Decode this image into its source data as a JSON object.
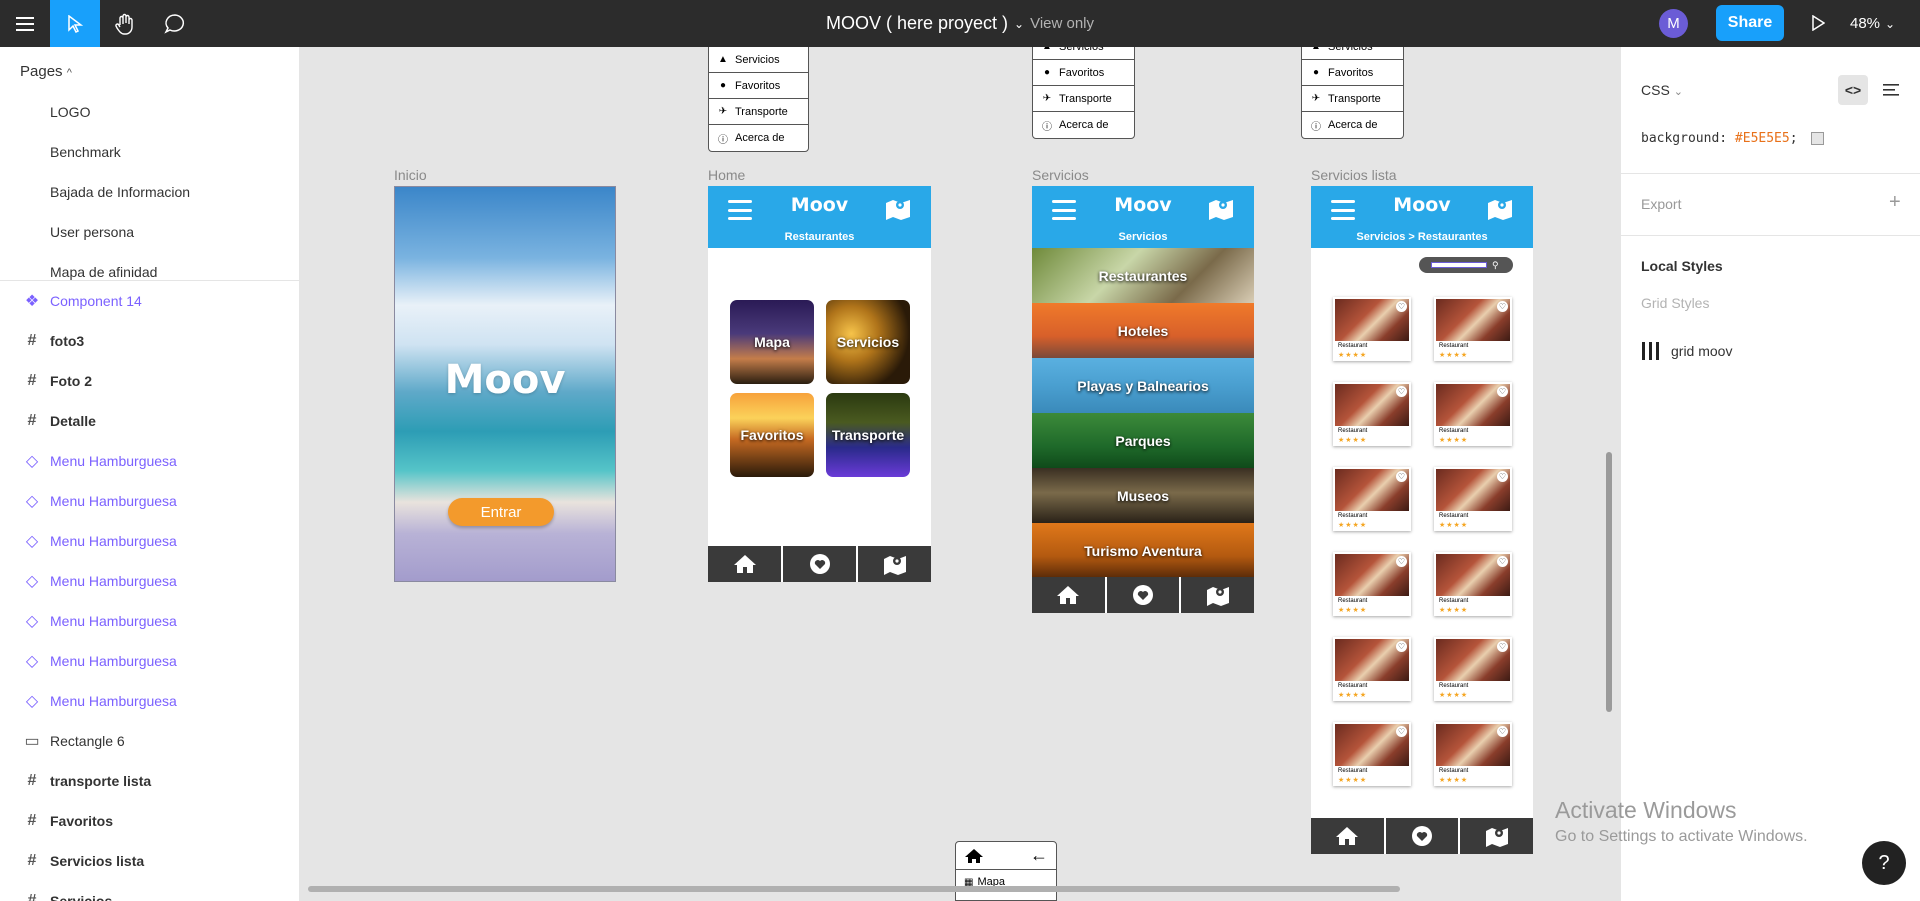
{
  "topbar": {
    "title": "MOOV ( here proyect )",
    "view_only": "View only",
    "avatar_initial": "M",
    "share_label": "Share",
    "zoom": "48%"
  },
  "pages": {
    "header": "Pages",
    "items": [
      "LOGO",
      "Benchmark",
      "Bajada de Informacion",
      "User persona",
      "Mapa de afinidad"
    ]
  },
  "layers": [
    {
      "label": "Component 14",
      "kind": "component"
    },
    {
      "label": "foto3",
      "kind": "frame"
    },
    {
      "label": "Foto 2",
      "kind": "frame"
    },
    {
      "label": "Detalle",
      "kind": "frame"
    },
    {
      "label": "Menu Hamburguesa",
      "kind": "instance"
    },
    {
      "label": "Menu Hamburguesa",
      "kind": "instance"
    },
    {
      "label": "Menu Hamburguesa",
      "kind": "instance"
    },
    {
      "label": "Menu Hamburguesa",
      "kind": "instance"
    },
    {
      "label": "Menu Hamburguesa",
      "kind": "instance"
    },
    {
      "label": "Menu Hamburguesa",
      "kind": "instance"
    },
    {
      "label": "Menu Hamburguesa",
      "kind": "instance"
    },
    {
      "label": "Rectangle 6",
      "kind": "rectangle"
    },
    {
      "label": "transporte lista",
      "kind": "frame"
    },
    {
      "label": "Favoritos",
      "kind": "frame"
    },
    {
      "label": "Servicios lista",
      "kind": "frame"
    },
    {
      "label": "Servicios",
      "kind": "frame"
    }
  ],
  "canvas": {
    "menu_items": [
      "Servicios",
      "Favoritos",
      "Transporte",
      "Acerca de"
    ],
    "bottom_menu": {
      "item": "Mapa"
    },
    "frames": {
      "inicio": {
        "label": "Inicio",
        "logo": "Moov",
        "button": "Entrar"
      },
      "home": {
        "label": "Home",
        "logo": "Moov",
        "subtitle": "Restaurantes",
        "tiles": [
          "Mapa",
          "Servicios",
          "Favoritos",
          "Transporte"
        ]
      },
      "servicios": {
        "label": "Servicios",
        "logo": "Moov",
        "subtitle": "Servicios",
        "bands": [
          "Restaurantes",
          "Hoteles",
          "Playas y Balnearios",
          "Parques",
          "Museos",
          "Turismo Aventura"
        ]
      },
      "servicios_lista": {
        "label": "Servicios lista",
        "logo": "Moov",
        "subtitle": "Servicios  > Restaurantes",
        "card_name": "Restaurant",
        "card_stars": "★★★★",
        "rows": 6
      }
    }
  },
  "inspector": {
    "tab": "CSS",
    "css_property": "background:",
    "css_value": "#E5E5E5",
    "css_end": ";",
    "export": "Export",
    "local_styles": "Local Styles",
    "grid_styles": "Grid Styles",
    "grid_item": "grid moov"
  },
  "watermark": {
    "line1": "Activate Windows",
    "line2": "Go to Settings to activate Windows."
  },
  "help": "?"
}
